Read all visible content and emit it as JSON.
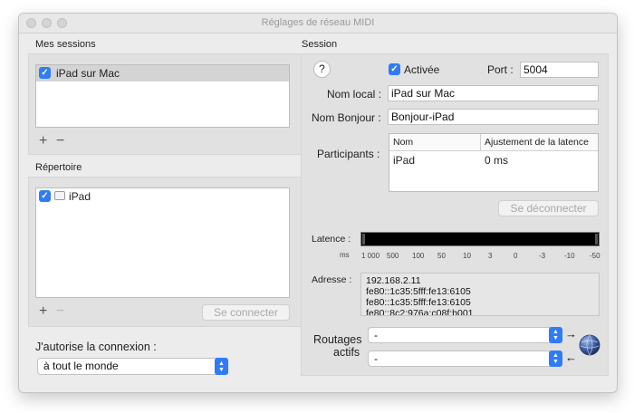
{
  "window": {
    "title": "Réglages de réseau MIDI"
  },
  "left": {
    "sessions_header": "Mes sessions",
    "sessions": [
      {
        "label": "iPad sur Mac",
        "checked": true
      }
    ],
    "add_symbol": "+",
    "remove_symbol": "−",
    "directory_header": "Répertoire",
    "directory": [
      {
        "label": "iPad",
        "checked": true
      }
    ],
    "connect_button": "Se connecter",
    "allow_label": "J'autorise la connexion :",
    "allow_select_value": "à tout le monde"
  },
  "session": {
    "header": "Session",
    "help_symbol": "?",
    "enabled_label": "Activée",
    "enabled_checked": true,
    "port_label": "Port :",
    "port_value": "5004",
    "local_name_label": "Nom local :",
    "local_name_value": "iPad sur Mac",
    "bonjour_name_label": "Nom Bonjour :",
    "bonjour_name_value": "Bonjour-iPad",
    "participants_label": "Participants :",
    "participants_columns": [
      "Nom",
      "Ajustement de la latence"
    ],
    "participants": [
      {
        "name": "iPad",
        "latency": "0 ms"
      }
    ],
    "disconnect_button": "Se déconnecter",
    "latency_label": "Latence :",
    "latency_unit": "ms",
    "latency_ticks": [
      "1 000",
      "500",
      "100",
      "50",
      "10",
      "3",
      "0",
      "-3",
      "-10",
      "-50"
    ],
    "address_label": "Adresse :",
    "addresses": [
      "192.168.2.11",
      "fe80::1c35:5fff:fe13:6105",
      "fe80::1c35:5fff:fe13:6105",
      "fe80::8c2:976a:c08f:b001"
    ],
    "routing_label_1": "Routages",
    "routing_label_2": "actifs",
    "routing_in_value": "-",
    "routing_out_value": "-",
    "arrow_right": "→",
    "arrow_left": "←"
  },
  "colors": {
    "accent": "#2f7cf6",
    "background": "#ececec",
    "panel": "#e1e1e1"
  },
  "icons": [
    "traffic-light-icon",
    "checkbox-icon",
    "ipad-device-icon",
    "network-globe-icon",
    "arrow-right-icon",
    "arrow-left-icon",
    "select-stepper-icon"
  ]
}
